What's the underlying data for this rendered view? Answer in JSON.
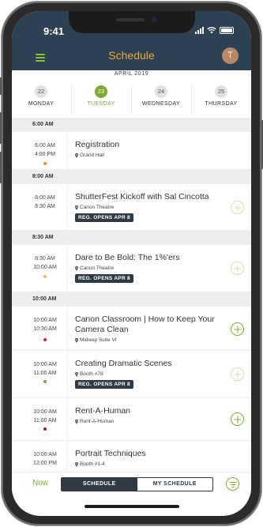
{
  "status": {
    "time": "9:41"
  },
  "header": {
    "title": "Schedule",
    "avatar_initial": "T"
  },
  "calendar": {
    "month": "APRIL 2019",
    "days": [
      {
        "num": "22",
        "name": "MONDAY"
      },
      {
        "num": "23",
        "name": "TUESDAY",
        "active": true
      },
      {
        "num": "24",
        "name": "WEDNESDAY"
      },
      {
        "num": "25",
        "name": "THURSDAY"
      }
    ]
  },
  "schedule": {
    "groups": [
      {
        "label": "6:00 AM"
      },
      {
        "label": "8:00 AM"
      },
      {
        "label": "8:30 AM"
      },
      {
        "label": "10:00 AM"
      }
    ],
    "events": [
      {
        "start": "6:00 AM",
        "end": "4:00 PM",
        "title": "Registration",
        "location": "Grand Hall",
        "dot_color": "#e58a3a"
      },
      {
        "start": "8:00 AM",
        "end": "8:30 AM",
        "title": "ShutterFest Kickoff with Sal Cincotta",
        "location": "Canon Theatre",
        "badge": "REG. OPENS APR 8"
      },
      {
        "start": "8:30 AM",
        "end": "10:00 AM",
        "title": "Dare to Be Bold: The 1%'ers",
        "location": "Canon Theatre",
        "badge": "REG. OPENS APR 8",
        "dot_color": "#d6c465"
      },
      {
        "start": "10:00 AM",
        "end": "10:30 AM",
        "title_line1": "Canon Classroom | How to Keep Your",
        "title_line2": "Camera Clean",
        "location": "Midway Suite VI",
        "dot_color": "#d0202a"
      },
      {
        "start": "10:00 AM",
        "end": "11:00 AM",
        "title": "Creating Dramatic Scenes",
        "location": "Booth #78",
        "badge": "REG. OPENS APR 8",
        "dot_color": "#7ea934"
      },
      {
        "start": "10:00 AM",
        "end": "11:00 AM",
        "title": "Rent-A-Human",
        "location": "Rent-A-Human",
        "dot_color": "#8a2040"
      },
      {
        "start": "10:00 AM",
        "end": "12:00 PM",
        "title": "Portrait Techniques",
        "location": "Booth #1-4"
      }
    ]
  },
  "tabbar": {
    "now": "Now",
    "tab_schedule": "SCHEDULE",
    "tab_my_schedule": "MY SCHEDULE"
  },
  "colors": {
    "header_bg": "#2e4152",
    "accent_green": "#7ea934",
    "title_orange": "#e9a93c"
  }
}
